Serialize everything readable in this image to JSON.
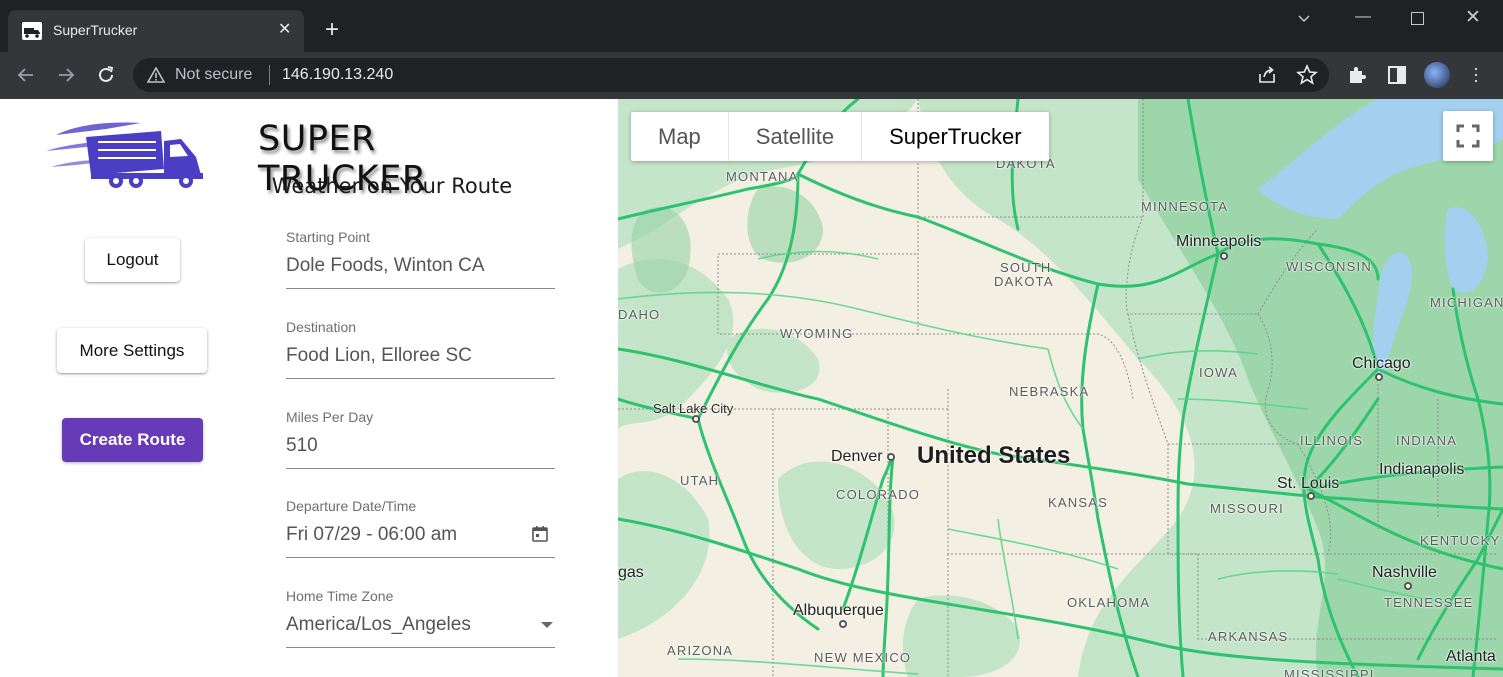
{
  "browser": {
    "tab_title": "SuperTrucker",
    "tab_close": "✕",
    "new_tab": "+",
    "not_secure": "Not secure",
    "url": "146.190.13.240"
  },
  "app": {
    "brand_title": "SUPER TRUCKER",
    "brand_subtitle": "Weather on Your Route",
    "buttons": {
      "logout": "Logout",
      "more_settings": "More Settings",
      "create_route": "Create Route"
    },
    "accent_color": "#673ab7",
    "fields": {
      "starting_point": {
        "label": "Starting Point",
        "value": "Dole Foods, Winton CA"
      },
      "destination": {
        "label": "Destination",
        "value": "Food Lion, Elloree SC"
      },
      "miles_per_day": {
        "label": "Miles Per Day",
        "value": "510"
      },
      "departure": {
        "label": "Departure Date/Time",
        "value": "Fri 07/29 - 06:00 am"
      },
      "home_time_zone": {
        "label": "Home Time Zone",
        "value": "America/Los_Angeles"
      }
    }
  },
  "map": {
    "map_types": [
      "Map",
      "Satellite",
      "SuperTrucker"
    ],
    "active_map_type": "SuperTrucker",
    "states": {
      "dakota": "DAKOTA",
      "montana": "MONTANA",
      "minnesota": "MINNESOTA",
      "south_dakota_1": "SOUTH",
      "south_dakota_2": "DAKOTA",
      "wisconsin": "WISCONSIN",
      "michigan": "MICHIGAN",
      "idaho": "DAHO",
      "wyoming": "WYOMING",
      "iowa": "IOWA",
      "nebraska": "NEBRASKA",
      "illinois": "ILLINOIS",
      "indiana": "INDIANA",
      "utah": "UTAH",
      "colorado": "COLORADO",
      "kansas": "KANSAS",
      "missouri": "MISSOURI",
      "kentucky": "KENTUCKY",
      "tennessee": "TENNESSEE",
      "oklahoma": "OKLAHOMA",
      "arkansas": "ARKANSAS",
      "arizona": "ARIZONA",
      "new_mexico": "NEW MEXICO",
      "mississippi": "MISSISSIPPI"
    },
    "cities": {
      "minneapolis": "Minneapolis",
      "chicago": "Chicago",
      "salt_lake_city": "Salt Lake City",
      "denver": "Denver",
      "st_louis": "St. Louis",
      "indianapolis": "Indianapolis",
      "nashville": "Nashville",
      "albuquerque": "Albuquerque",
      "atlanta": "Atlanta",
      "las_vegas": "gas"
    },
    "country": "United States"
  }
}
